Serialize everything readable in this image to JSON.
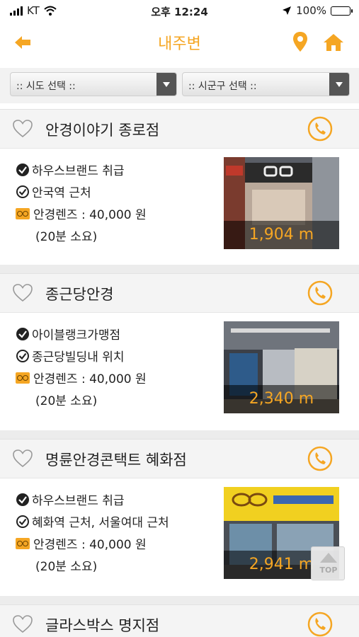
{
  "status_bar": {
    "carrier": "KT",
    "time": "오후 12:24",
    "battery": "100%"
  },
  "nav": {
    "title": "내주변"
  },
  "filters": {
    "sido": ":: 시도 선택 ::",
    "sigungu": ":: 시군구 선택 ::"
  },
  "stores": [
    {
      "name": "안경이야기 종로점",
      "features": [
        "하우스브랜드 취급",
        "안국역 근처"
      ],
      "lens_price": "안경렌즈 : 40,000 원",
      "duration": "(20분 소요)",
      "distance": "1,904 m"
    },
    {
      "name": "종근당안경",
      "features": [
        "아이블랭크가맹점",
        "종근당빌딩내 위치"
      ],
      "lens_price": "안경렌즈 : 40,000 원",
      "duration": "(20분 소요)",
      "distance": "2,340 m"
    },
    {
      "name": "명륜안경콘택트 혜화점",
      "features": [
        "하우스브랜드 취급",
        "혜화역 근처, 서울여대 근처"
      ],
      "lens_price": "안경렌즈 : 40,000 원",
      "duration": "(20분 소요)",
      "distance": "2,941 m"
    },
    {
      "name": "글라스박스 명지점"
    }
  ],
  "top_button": "TOP",
  "colors": {
    "accent": "#f5a623",
    "header_bg": "#f4f4f4"
  }
}
